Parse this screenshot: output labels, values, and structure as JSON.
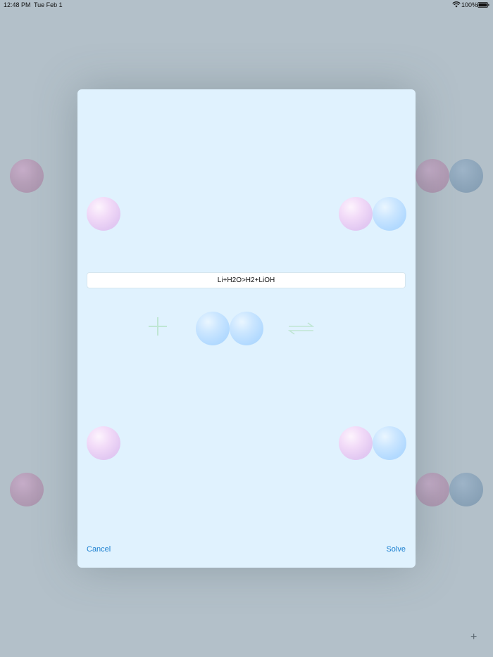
{
  "status_bar": {
    "time": "12:48 PM",
    "date": "Tue Feb 1",
    "battery": "100%"
  },
  "modal": {
    "equation_value": "Li+H2O>H2+LiOH",
    "cancel_label": "Cancel",
    "solve_label": "Solve"
  },
  "corner_button": {
    "label": "+"
  },
  "colors": {
    "accent": "#1a7fd0",
    "modal_background": "#e0f2fe",
    "backdrop": "#b3c0c9",
    "operator_green": "#bfe6d4"
  }
}
